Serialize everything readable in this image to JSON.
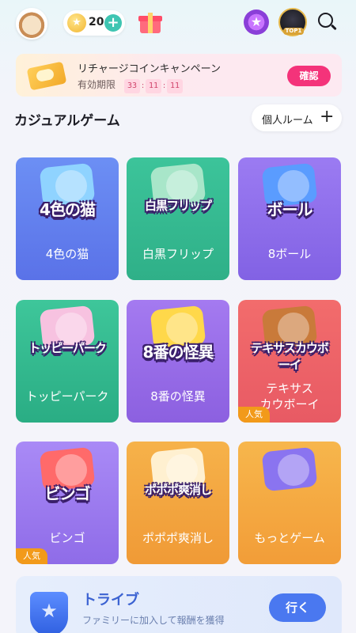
{
  "header": {
    "coin_count": "20",
    "coin_plus": "+",
    "top_badge": "TOP1"
  },
  "banner": {
    "title": "リチャージコインキャンペーン",
    "deadline_label": "有効期限",
    "countdown": [
      "33",
      "11",
      "11"
    ],
    "confirm_label": "確認"
  },
  "section": {
    "title": "カジュアルゲーム",
    "room_button_label": "個人ルーム",
    "room_button_plus": "+"
  },
  "games": [
    {
      "name": "4色の猫",
      "art_title": "4色の猫",
      "badge": "",
      "bg": "#6c8ff4",
      "bg2": "#5a72e8",
      "art": "#8fd3ff"
    },
    {
      "name": "白黒フリップ",
      "art_title": "白黒フリップ",
      "badge": "",
      "bg": "#3cc49a",
      "bg2": "#2fb088",
      "art": "#a8e6c9"
    },
    {
      "name": "8ボール",
      "art_title": "ボール",
      "badge": "",
      "bg": "#9b7bf2",
      "bg2": "#8262e4",
      "art": "#5a9cff"
    },
    {
      "name": "トッピーパーク",
      "art_title": "トッピーパーク",
      "badge": "",
      "bg": "#3ec69a",
      "bg2": "#2aad84",
      "art": "#f7c2e0"
    },
    {
      "name": "8番の怪異",
      "art_title": "8番の怪異",
      "badge": "",
      "bg": "#a47af0",
      "bg2": "#8c60e0",
      "art": "#ffd84a"
    },
    {
      "name": "テキサス\nカウボーイ",
      "art_title": "テキサスカウボーイ",
      "badge": "人気",
      "bg": "#f26c6c",
      "bg2": "#e85a64",
      "art": "#c97a3a"
    },
    {
      "name": "ビンゴ",
      "art_title": "ビンゴ",
      "badge": "人気",
      "bg": "#a98af6",
      "bg2": "#8f6ce8",
      "art": "#ff6a6a"
    },
    {
      "name": "ポポポ爽消し",
      "art_title": "ポポポ爽消し",
      "badge": "",
      "bg": "#f6b24a",
      "bg2": "#f09a36",
      "art": "#fff0d0"
    },
    {
      "name": "もっとゲーム",
      "art_title": "",
      "badge": "",
      "bg": "#f7b64c",
      "bg2": "#f29d38",
      "art": "#8a74f0"
    }
  ],
  "tribe": {
    "title": "トライブ",
    "description": "ファミリーに加入して報酬を獲得",
    "button_label": "行く"
  },
  "colors": {
    "accent_pink": "#f4337a",
    "accent_blue": "#4a78f0",
    "coin_green": "#3fc5b2"
  }
}
